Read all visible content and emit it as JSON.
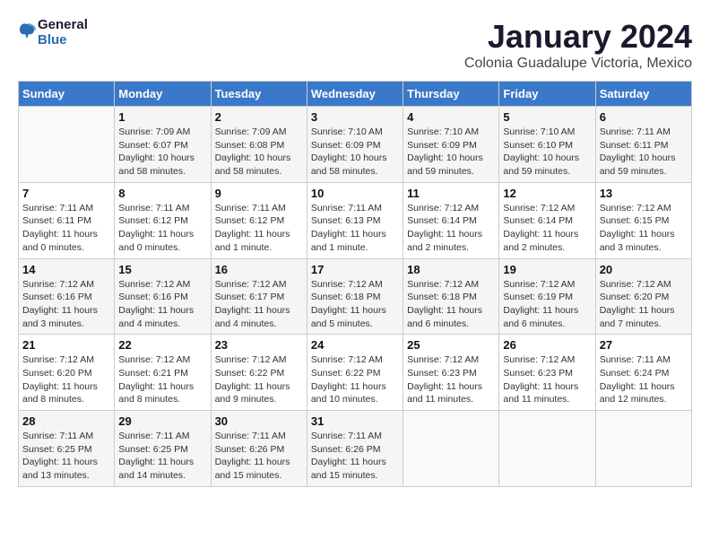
{
  "header": {
    "logo_line1": "General",
    "logo_line2": "Blue",
    "month_title": "January 2024",
    "location": "Colonia Guadalupe Victoria, Mexico"
  },
  "days_of_week": [
    "Sunday",
    "Monday",
    "Tuesday",
    "Wednesday",
    "Thursday",
    "Friday",
    "Saturday"
  ],
  "weeks": [
    [
      {
        "day": "",
        "info": ""
      },
      {
        "day": "1",
        "info": "Sunrise: 7:09 AM\nSunset: 6:07 PM\nDaylight: 10 hours\nand 58 minutes."
      },
      {
        "day": "2",
        "info": "Sunrise: 7:09 AM\nSunset: 6:08 PM\nDaylight: 10 hours\nand 58 minutes."
      },
      {
        "day": "3",
        "info": "Sunrise: 7:10 AM\nSunset: 6:09 PM\nDaylight: 10 hours\nand 58 minutes."
      },
      {
        "day": "4",
        "info": "Sunrise: 7:10 AM\nSunset: 6:09 PM\nDaylight: 10 hours\nand 59 minutes."
      },
      {
        "day": "5",
        "info": "Sunrise: 7:10 AM\nSunset: 6:10 PM\nDaylight: 10 hours\nand 59 minutes."
      },
      {
        "day": "6",
        "info": "Sunrise: 7:11 AM\nSunset: 6:11 PM\nDaylight: 10 hours\nand 59 minutes."
      }
    ],
    [
      {
        "day": "7",
        "info": "Sunrise: 7:11 AM\nSunset: 6:11 PM\nDaylight: 11 hours\nand 0 minutes."
      },
      {
        "day": "8",
        "info": "Sunrise: 7:11 AM\nSunset: 6:12 PM\nDaylight: 11 hours\nand 0 minutes."
      },
      {
        "day": "9",
        "info": "Sunrise: 7:11 AM\nSunset: 6:12 PM\nDaylight: 11 hours\nand 1 minute."
      },
      {
        "day": "10",
        "info": "Sunrise: 7:11 AM\nSunset: 6:13 PM\nDaylight: 11 hours\nand 1 minute."
      },
      {
        "day": "11",
        "info": "Sunrise: 7:12 AM\nSunset: 6:14 PM\nDaylight: 11 hours\nand 2 minutes."
      },
      {
        "day": "12",
        "info": "Sunrise: 7:12 AM\nSunset: 6:14 PM\nDaylight: 11 hours\nand 2 minutes."
      },
      {
        "day": "13",
        "info": "Sunrise: 7:12 AM\nSunset: 6:15 PM\nDaylight: 11 hours\nand 3 minutes."
      }
    ],
    [
      {
        "day": "14",
        "info": "Sunrise: 7:12 AM\nSunset: 6:16 PM\nDaylight: 11 hours\nand 3 minutes."
      },
      {
        "day": "15",
        "info": "Sunrise: 7:12 AM\nSunset: 6:16 PM\nDaylight: 11 hours\nand 4 minutes."
      },
      {
        "day": "16",
        "info": "Sunrise: 7:12 AM\nSunset: 6:17 PM\nDaylight: 11 hours\nand 4 minutes."
      },
      {
        "day": "17",
        "info": "Sunrise: 7:12 AM\nSunset: 6:18 PM\nDaylight: 11 hours\nand 5 minutes."
      },
      {
        "day": "18",
        "info": "Sunrise: 7:12 AM\nSunset: 6:18 PM\nDaylight: 11 hours\nand 6 minutes."
      },
      {
        "day": "19",
        "info": "Sunrise: 7:12 AM\nSunset: 6:19 PM\nDaylight: 11 hours\nand 6 minutes."
      },
      {
        "day": "20",
        "info": "Sunrise: 7:12 AM\nSunset: 6:20 PM\nDaylight: 11 hours\nand 7 minutes."
      }
    ],
    [
      {
        "day": "21",
        "info": "Sunrise: 7:12 AM\nSunset: 6:20 PM\nDaylight: 11 hours\nand 8 minutes."
      },
      {
        "day": "22",
        "info": "Sunrise: 7:12 AM\nSunset: 6:21 PM\nDaylight: 11 hours\nand 8 minutes."
      },
      {
        "day": "23",
        "info": "Sunrise: 7:12 AM\nSunset: 6:22 PM\nDaylight: 11 hours\nand 9 minutes."
      },
      {
        "day": "24",
        "info": "Sunrise: 7:12 AM\nSunset: 6:22 PM\nDaylight: 11 hours\nand 10 minutes."
      },
      {
        "day": "25",
        "info": "Sunrise: 7:12 AM\nSunset: 6:23 PM\nDaylight: 11 hours\nand 11 minutes."
      },
      {
        "day": "26",
        "info": "Sunrise: 7:12 AM\nSunset: 6:23 PM\nDaylight: 11 hours\nand 11 minutes."
      },
      {
        "day": "27",
        "info": "Sunrise: 7:11 AM\nSunset: 6:24 PM\nDaylight: 11 hours\nand 12 minutes."
      }
    ],
    [
      {
        "day": "28",
        "info": "Sunrise: 7:11 AM\nSunset: 6:25 PM\nDaylight: 11 hours\nand 13 minutes."
      },
      {
        "day": "29",
        "info": "Sunrise: 7:11 AM\nSunset: 6:25 PM\nDaylight: 11 hours\nand 14 minutes."
      },
      {
        "day": "30",
        "info": "Sunrise: 7:11 AM\nSunset: 6:26 PM\nDaylight: 11 hours\nand 15 minutes."
      },
      {
        "day": "31",
        "info": "Sunrise: 7:11 AM\nSunset: 6:26 PM\nDaylight: 11 hours\nand 15 minutes."
      },
      {
        "day": "",
        "info": ""
      },
      {
        "day": "",
        "info": ""
      },
      {
        "day": "",
        "info": ""
      }
    ]
  ]
}
